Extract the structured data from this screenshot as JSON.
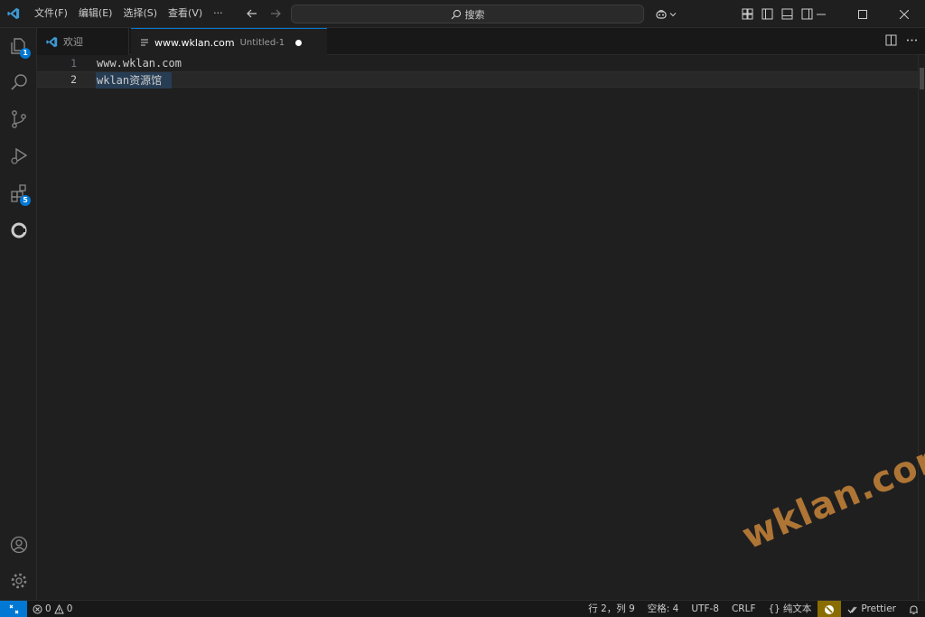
{
  "titlebar": {
    "menu": [
      "文件(F)",
      "编辑(E)",
      "选择(S)",
      "查看(V)",
      "···"
    ],
    "search_label": "搜索"
  },
  "activitybar": {
    "explorer_badge": "1",
    "extensions_badge": "5"
  },
  "tabs": {
    "welcome_label": "欢迎",
    "active_label": "www.wklan.com",
    "active_description": "Untitled-1"
  },
  "editor": {
    "lines": [
      {
        "number": "1",
        "text": "www.wklan.com"
      },
      {
        "number": "2",
        "text": "wklan资源馆"
      }
    ]
  },
  "watermark": "wklan.com",
  "statusbar": {
    "errors": "0",
    "warnings": "0",
    "cursor": "行 2，列 9",
    "indent": "空格: 4",
    "encoding": "UTF-8",
    "eol": "CRLF",
    "language": "纯文本",
    "formatter": "Prettier"
  },
  "colors": {
    "accent": "#0078d4",
    "background": "#1f1f1f",
    "watermark": "#c9853a"
  }
}
